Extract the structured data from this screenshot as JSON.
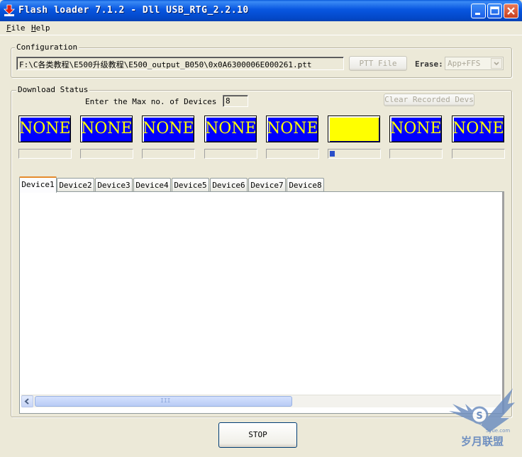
{
  "window": {
    "title": "Flash loader 7.1.2 - Dll USB_RTG_2.2.10",
    "colors": {
      "titlebar": "#0856e0",
      "device_box": "#0000ff",
      "device_text": "#ffff00",
      "active_device": "#ffff00"
    }
  },
  "menu": {
    "file": {
      "accel": "F",
      "rest": "ile"
    },
    "help": {
      "accel": "H",
      "rest": "elp"
    }
  },
  "configuration": {
    "label": "Configuration",
    "path": "F:\\C各类教程\\E500升级教程\\E500_output_B050\\0x0A6300006E000261.ptt",
    "ptt_button": "PTT File",
    "erase_label": "Erase:",
    "erase_value": "App+FFS"
  },
  "download_status": {
    "label": "Download Status",
    "max_devices_label": "Enter the Max no. of Devices",
    "max_devices_value": "8",
    "clear_button": "Clear Recorded Devs",
    "devices": [
      {
        "status": "NONE",
        "progress": 0
      },
      {
        "status": "NONE",
        "progress": 0
      },
      {
        "status": "NONE",
        "progress": 0
      },
      {
        "status": "NONE",
        "progress": 0
      },
      {
        "status": "NONE",
        "progress": 0
      },
      {
        "status": "",
        "progress": 0.1
      },
      {
        "status": "NONE",
        "progress": 0
      },
      {
        "status": "NONE",
        "progress": 0
      }
    ]
  },
  "tabs": [
    "Device1",
    "Device2",
    "Device3",
    "Device4",
    "Device5",
    "Device6",
    "Device7",
    "Device8"
  ],
  "stop_button": "STOP",
  "scrollbar_grip": "III",
  "watermark": {
    "text": "5yue.com",
    "brand": "岁月联盟",
    "logo_letter": "S"
  }
}
